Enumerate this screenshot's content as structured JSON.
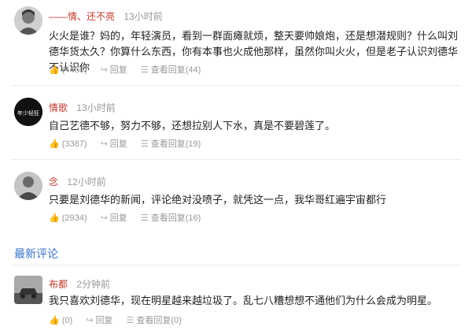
{
  "comments": [
    {
      "user": "——情、还不亮",
      "time": "13小时前",
      "text": "火火是谁？妈的，年轻演员，看到一群面瘫就烦，整天要帅娘炮，还是想潜规则？什么叫刘德华货太久？你算什么东西，你有本事也火成他那样，虽然你叫火火，但是老子认识刘德华不认识你",
      "likes": "(4468)",
      "reply": "回复",
      "view": "查看回复(44)"
    },
    {
      "user": "情歌",
      "time": "13小时前",
      "avatar_text": "年少轻狂",
      "text": "自己艺德不够，努力不够，还想拉别人下水，真是不要碧莲了。",
      "likes": "(3387)",
      "reply": "回复",
      "view": "查看回复(19)"
    },
    {
      "user": "念",
      "time": "12小时前",
      "text": "只要是刘德华的新闻，评论绝对没喷子，就凭这一点，我华哥红遍宇宙都行",
      "likes": "(2934)",
      "reply": "回复",
      "view": "查看回复(16)"
    }
  ],
  "section_title": "最新评论",
  "latest": {
    "user": "布都",
    "time": "2分钟前",
    "text": "我只喜欢刘德华，现在明星越来越垃圾了。乱七八糟想想不通他们为什么会成为明星。",
    "likes": "(0)",
    "reply": "回复",
    "view": "查看回复(0)"
  },
  "colors": {
    "username": "#c0392b",
    "section": "#3a74c8",
    "meta": "#999999"
  },
  "icons": [
    "thumbs-up-icon",
    "reply-arrow-icon",
    "view-replies-icon"
  ]
}
